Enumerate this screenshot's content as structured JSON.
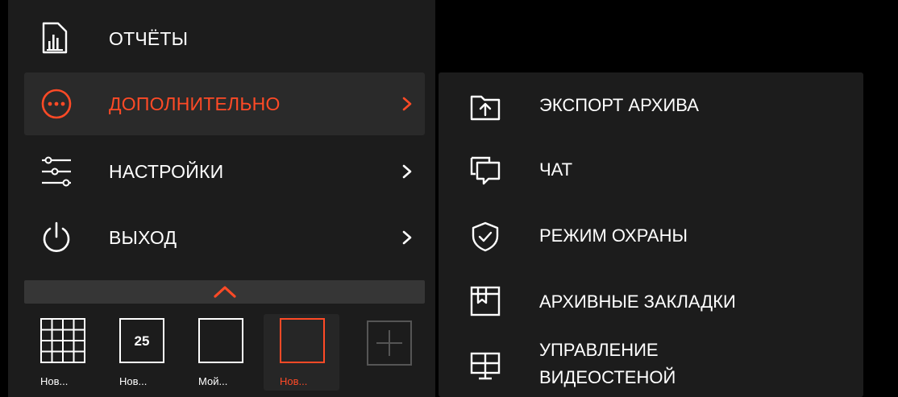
{
  "colors": {
    "accent": "#ff4a26",
    "panel": "#1c1c1c",
    "active_bg": "#2a2a2a",
    "text": "#ffffff"
  },
  "main_menu": {
    "items": [
      {
        "label": "ОТЧЁТЫ",
        "icon": "report-icon",
        "active": false,
        "has_submenu": false
      },
      {
        "label": "ДОПОЛНИТЕЛЬНО",
        "icon": "more-dots-icon",
        "active": true,
        "has_submenu": true
      },
      {
        "label": "НАСТРОЙКИ",
        "icon": "sliders-icon",
        "active": false,
        "has_submenu": true
      },
      {
        "label": "ВЫХОД",
        "icon": "power-icon",
        "active": false,
        "has_submenu": true
      }
    ]
  },
  "layouts": {
    "tiles": [
      {
        "label": "Нов...",
        "thumb": "grid-4x4",
        "active": false
      },
      {
        "label": "Нов...",
        "thumb": "25",
        "active": false
      },
      {
        "label": "Мой...",
        "thumb": "single",
        "active": false
      },
      {
        "label": "Нов...",
        "thumb": "single",
        "active": true
      }
    ],
    "add_icon": "plus-icon"
  },
  "submenu": {
    "items": [
      {
        "label": "ЭКСПОРТ АРХИВА",
        "icon": "folder-upload-icon"
      },
      {
        "label": "ЧАТ",
        "icon": "chat-icon"
      },
      {
        "label": "РЕЖИМ ОХРАНЫ",
        "icon": "shield-check-icon"
      },
      {
        "label": "АРХИВНЫЕ ЗАКЛАДКИ",
        "icon": "bookmark-icon"
      },
      {
        "label_line1": "УПРАВЛЕНИЕ",
        "label_line2": "ВИДЕОСТЕНОЙ",
        "icon": "video-wall-icon"
      }
    ]
  }
}
